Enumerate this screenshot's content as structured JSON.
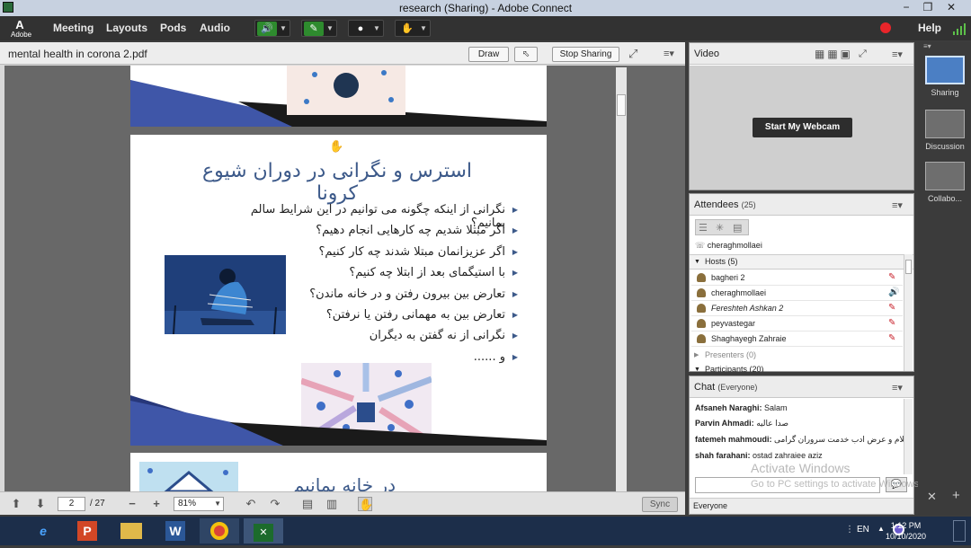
{
  "window": {
    "title": "research (Sharing) - Adobe Connect",
    "minimize": "−",
    "restore": "❐",
    "close": "✕"
  },
  "menubar": {
    "logo_letter": "A",
    "logo_text": "Adobe",
    "items": [
      "Meeting",
      "Layouts",
      "Pods",
      "Audio"
    ],
    "help": "Help"
  },
  "share_pod": {
    "filename": "mental health in corona 2.pdf",
    "draw_label": "Draw",
    "stop_sharing_label": "Stop Sharing",
    "page_current": "2",
    "page_total": "/ 27",
    "zoom": "81%",
    "sync_label": "Sync"
  },
  "slide": {
    "heading": "استرس و نگرانی در دوران شیوع کرونا",
    "bullets": [
      "نگرانی از اینکه چگونه می توانیم در این شرایط سالم بمانیم؟",
      "اگر مبتلا شدیم چه کارهایی انجام دهیم؟",
      "اگر عزیزانمان مبتلا شدند چه کار کنیم؟",
      "با استیگمای بعد از ابتلا چه کنیم؟",
      "تعارض بین بیرون رفتن و در خانه ماندن؟",
      "تعارض بین به مهمانی رفتن یا نرفتن؟",
      "نگرانی از نه گفتن به دیگران",
      "و ......"
    ],
    "next_slide_heading": "در خانه بمانیم"
  },
  "video_pod": {
    "title": "Video",
    "webcam_button": "Start My Webcam"
  },
  "attendees_pod": {
    "title": "Attendees",
    "count": "(25)",
    "current_user": "cheraghmollaei",
    "hosts_label": "Hosts (5)",
    "hosts": [
      {
        "name": "bagheri 2",
        "italic": false,
        "speaking": false
      },
      {
        "name": "cheraghmollaei",
        "italic": false,
        "speaking": true
      },
      {
        "name": "Fereshteh Ashkan 2",
        "italic": true,
        "speaking": false
      },
      {
        "name": "peyvastegar",
        "italic": false,
        "speaking": false
      },
      {
        "name": "Shaghayegh Zahraie",
        "italic": false,
        "speaking": false
      }
    ],
    "presenters_label": "Presenters (0)",
    "participants_label": "Participants (20)"
  },
  "chat_pod": {
    "title": "Chat",
    "scope": "(Everyone)",
    "messages": [
      {
        "sender": "Afsaneh Naraghi:",
        "text": "Salam"
      },
      {
        "sender": "Parvin Ahmadi:",
        "text": "صدا عالیه"
      },
      {
        "sender": "fatemeh mahmoudi:",
        "text": "سلام و عرض ادب خدمت سروران گرامی"
      },
      {
        "sender": "shah farahani:",
        "text": "ostad zahraiee aziz"
      }
    ],
    "recipient": "Everyone",
    "watermark_title": "Activate Windows",
    "watermark_sub": "Go to PC settings to activate Windows."
  },
  "layouts_rail": {
    "items": [
      "Sharing",
      "Discussion",
      "Collabo..."
    ]
  },
  "taskbar": {
    "language": "EN",
    "time": "1:12 PM",
    "date": "10/10/2020"
  }
}
